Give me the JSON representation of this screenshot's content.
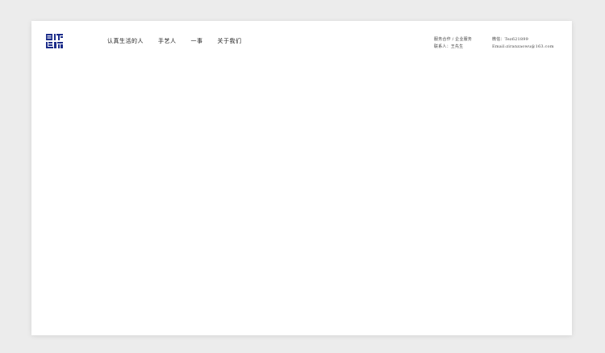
{
  "brand": {
    "logo_text": "自然造物",
    "accent_color": "#1c2d8a"
  },
  "nav": {
    "items": [
      {
        "label": "认真生活的人"
      },
      {
        "label": "手艺人"
      },
      {
        "label": "一事"
      },
      {
        "label": "关于我们"
      }
    ]
  },
  "contact": {
    "service": "服务合作 / 企业服务",
    "person": "联系人：王先生",
    "wechat": "微信：Tez621899",
    "email": "Email:ziranzaowu@163.com"
  }
}
